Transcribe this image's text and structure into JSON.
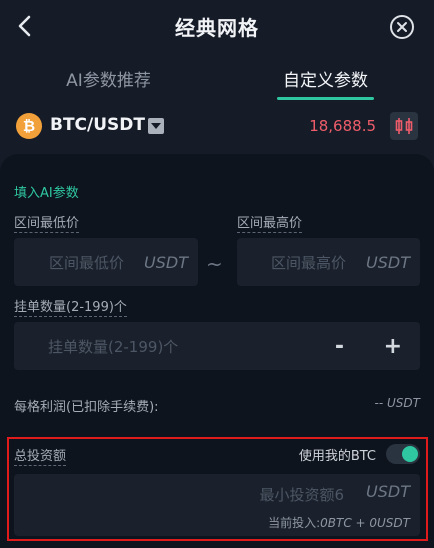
{
  "header": {
    "title": "经典网格"
  },
  "tabs": [
    {
      "label": "AI参数推荐",
      "active": false
    },
    {
      "label": "自定义参数",
      "active": true
    }
  ],
  "pair": {
    "coin_letter": "₿",
    "name": "BTC/USDT",
    "price": "18,688.5"
  },
  "form": {
    "ai_fill": "填入AI参数",
    "price_min": {
      "label": "区间最低价",
      "placeholder": "区间最低价",
      "unit": "USDT"
    },
    "range_sep": "~",
    "price_max": {
      "label": "区间最高价",
      "placeholder": "区间最高价",
      "unit": "USDT"
    },
    "grid_count": {
      "label": "挂单数量(2-199)个",
      "placeholder": "挂单数量(2-199)个",
      "minus": "-",
      "plus": "+"
    },
    "profit": {
      "label": "每格利润(已扣除手续费):",
      "value": "-- USDT"
    },
    "investment": {
      "label": "总投资额",
      "use_my_label": "使用我的BTC",
      "use_my_enabled": true,
      "placeholder": "最小投资额6",
      "unit": "USDT",
      "current_label": "当前投入:",
      "current_btc": "0BTC",
      "current_plus": " + ",
      "current_usdt": "0USDT"
    }
  },
  "colors": {
    "accent": "#2ec7a2",
    "price": "#ef5d6a",
    "highlight": "#e01b1b",
    "coin": "#f2a13a"
  }
}
